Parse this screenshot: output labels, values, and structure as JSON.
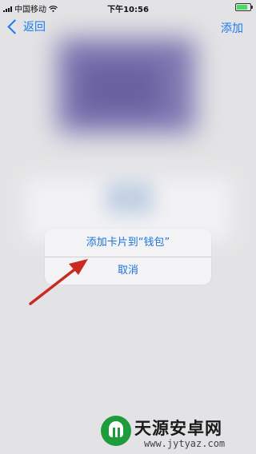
{
  "status_bar": {
    "carrier": "中国移动",
    "time": "下午10:56",
    "wifi_icon": "wifi-icon",
    "battery_icon": "battery-charging-icon"
  },
  "nav": {
    "back_label": "返回",
    "add_label": "添加"
  },
  "action_sheet": {
    "add_to_wallet_label": "添加卡片到“钱包”",
    "cancel_label": "取消"
  },
  "watermark": {
    "title": "天源安卓网",
    "url": "www.jytyaz.com"
  },
  "colors": {
    "accent": "#1a7aef",
    "arrow": "#c92b22",
    "background": "#e3e3e5"
  }
}
